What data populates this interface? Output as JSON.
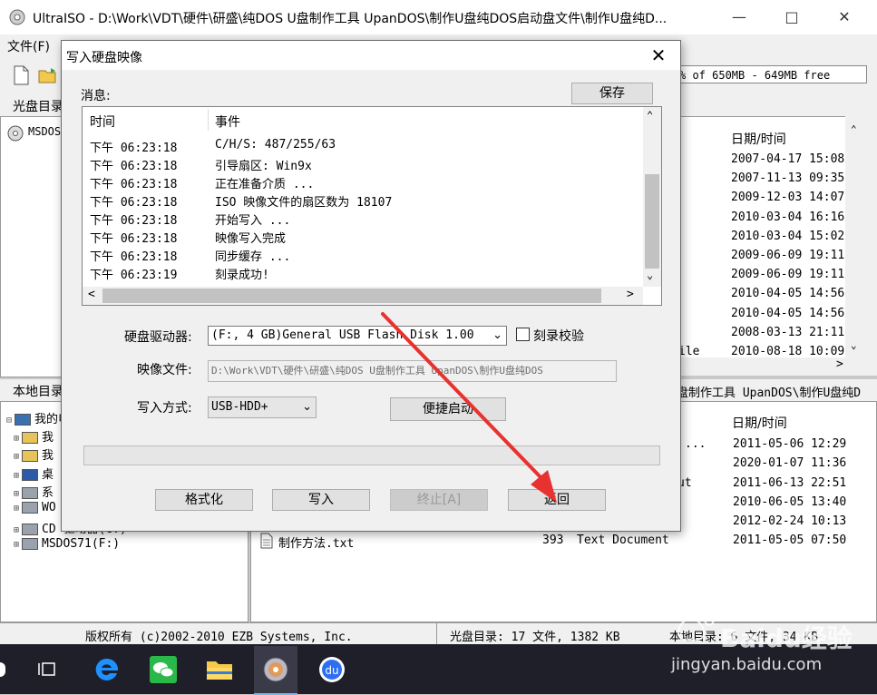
{
  "app": {
    "title": "UltraISO - D:\\Work\\VDT\\硬件\\研盛\\纯DOS U盘制作工具 UpanDOS\\制作U盘纯DOS启动盘文件\\制作U盘纯D...",
    "menu_file": "文件(F)",
    "free_space": "% of 650MB - 649MB free",
    "iso_pane_title": "光盘目录:",
    "iso_root": "MSDOS",
    "local_pane_title": "本地目录:",
    "local_path": "盘制作工具 UpanDOS\\制作U盘纯D",
    "date_header": "日期/时间",
    "status_copyright": "版权所有 (c)2002-2010 EZB Systems, Inc.",
    "status_iso": "光盘目录: 17 文件, 1382 KB",
    "status_local": "本地目录: 6 文件, 34 KB",
    "watermark": "Baidu经验",
    "watermark_url": "jingyan.baidu.com"
  },
  "iso_dates": [
    "2007-04-17 15:08",
    "2007-11-13 09:35",
    "2009-12-03 14:07",
    "2010-03-04 16:16",
    "2010-03-04 15:02",
    "2009-06-09 19:11",
    "2009-06-09 19:11",
    "2010-04-05 14:56",
    "2010-04-05 14:56",
    "2008-03-13 21:11",
    "2010-08-18 10:09"
  ],
  "iso_partial": "ile",
  "local_tree": [
    {
      "label": "我的电脑"
    },
    {
      "label": "我"
    },
    {
      "label": "我"
    },
    {
      "label": "桌"
    },
    {
      "label": "系"
    },
    {
      "label": "WO"
    },
    {
      "label": "CD 驱动器(G:)"
    },
    {
      "label": "MSDOS71(F:)"
    }
  ],
  "local_dates": [
    "2011-05-06 12:29",
    "2020-01-07 11:36",
    "2011-06-13 22:51",
    "2010-06-05 13:40",
    "2012-02-24 10:13",
    "2011-05-05 07:50"
  ],
  "local_partial": [
    "...",
    "ut"
  ],
  "local_file": {
    "name": "制作方法.txt",
    "size": "393",
    "type": "Text Document"
  },
  "dialog": {
    "title": "写入硬盘映像",
    "messages_label": "消息:",
    "save_button": "保存",
    "col_time": "时间",
    "col_event": "事件",
    "log": [
      {
        "time": "下午 06:23:18",
        "event": "C/H/S: 487/255/63"
      },
      {
        "time": "下午 06:23:18",
        "event": "引导扇区: Win9x"
      },
      {
        "time": "下午 06:23:18",
        "event": "正在准备介质 ..."
      },
      {
        "time": "下午 06:23:18",
        "event": "ISO 映像文件的扇区数为 18107"
      },
      {
        "time": "下午 06:23:18",
        "event": "开始写入 ..."
      },
      {
        "time": "下午 06:23:18",
        "event": "映像写入完成"
      },
      {
        "time": "下午 06:23:18",
        "event": "同步缓存 ..."
      },
      {
        "time": "下午 06:23:19",
        "event": "刻录成功!"
      }
    ],
    "drive_label": "硬盘驱动器:",
    "drive_value": "(F:, 4 GB)General USB Flash Disk  1.00",
    "verify_label": "刻录校验",
    "image_label": "映像文件:",
    "image_value": "D:\\Work\\VDT\\硬件\\研盛\\纯DOS U盘制作工具 UpanDOS\\制作U盘纯DOS",
    "write_method_label": "写入方式:",
    "write_method_value": "USB-HDD+",
    "quick_boot_button": "便捷启动",
    "progress": 0,
    "format_button": "格式化",
    "write_button": "写入",
    "stop_button": "终止[A]",
    "return_button": "返回"
  },
  "colors": {
    "arrow": "#e8322f",
    "progress_empty": "#e6e6e6"
  }
}
